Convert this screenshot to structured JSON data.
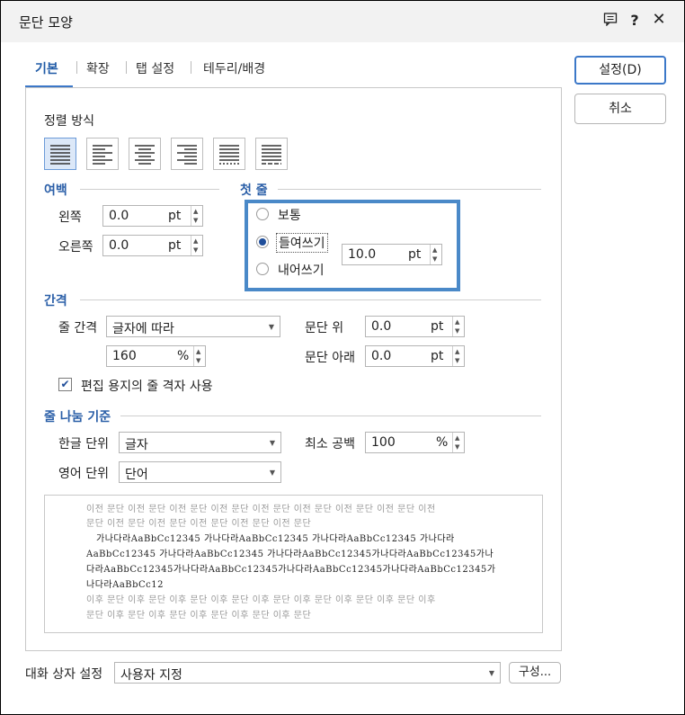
{
  "window": {
    "title": "문단 모양"
  },
  "tabs": [
    {
      "label": "기본"
    },
    {
      "label": "확장"
    },
    {
      "label": "탭 설정"
    },
    {
      "label": "테두리/배경"
    }
  ],
  "buttons": {
    "ok": "설정(D)",
    "cancel": "취소",
    "configure": "구성..."
  },
  "align": {
    "label": "정렬 방식",
    "options": [
      "양쪽 정렬",
      "왼쪽 정렬",
      "가운데 정렬",
      "오른쪽 정렬",
      "배분 정렬",
      "나눔 정렬"
    ],
    "selected": 0
  },
  "margin": {
    "title": "여백",
    "left_label": "왼쪽",
    "left_value": "0.0",
    "left_unit": "pt",
    "right_label": "오른쪽",
    "right_value": "0.0",
    "right_unit": "pt"
  },
  "first_line": {
    "title": "첫 줄",
    "options": [
      "보통",
      "들여쓰기",
      "내어쓰기"
    ],
    "selected": 1,
    "value": "10.0",
    "unit": "pt"
  },
  "spacing": {
    "title": "간격",
    "line_label": "줄 간격",
    "line_mode": "글자에 따라",
    "line_value": "160",
    "line_unit": "%",
    "above_label": "문단 위",
    "above_value": "0.0",
    "above_unit": "pt",
    "below_label": "문단 아래",
    "below_value": "0.0",
    "below_unit": "pt",
    "grid_check_label": "편집 용지의 줄 격자 사용",
    "grid_checked": true
  },
  "line_break": {
    "title": "줄 나눔 기준",
    "korean_label": "한글 단위",
    "korean_value": "글자",
    "english_label": "영어 단위",
    "english_value": "단어",
    "min_space_label": "최소 공백",
    "min_space_value": "100",
    "min_space_unit": "%"
  },
  "preview": {
    "lines": [
      "이전 문단 이전 문단 이전 문단 이전 문단 이전 문단 이전 문단 이전 문단 이전 문단 이전",
      "문단 이전 문단 이전 문단 이전 문단 이전 문단 이전 문단",
      "가나다라AaBbCc12345    가나다라AaBbCc12345    가나다라AaBbCc12345    가나다라",
      "AaBbCc12345    가나다라AaBbCc12345    가나다라AaBbCc12345가나다라AaBbCc12345가나",
      "다라AaBbCc12345가나다라AaBbCc12345가나다라AaBbCc12345가나다라AaBbCc12345가",
      "나다라AaBbCc12",
      "이후 문단 이후 문단 이후 문단 이후 문단 이후 문단 이후 문단 이후 문단 이후 문단 이후",
      "문단 이후 문단 이후 문단 이후 문단 이후 문단 이후 문단"
    ]
  },
  "footer": {
    "label": "대화 상자 설정",
    "value": "사용자 지정"
  }
}
